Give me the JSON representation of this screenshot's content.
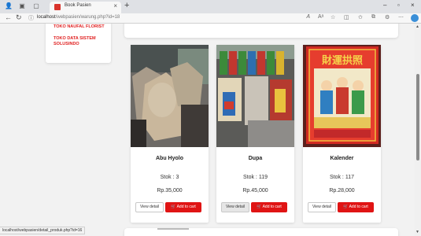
{
  "browser": {
    "tab_title": "Book Pasien",
    "tab_close": "×",
    "new_tab": "+",
    "url_host": "localhost",
    "url_path": "/webpasien/warung.php?id=18",
    "controls": {
      "minimize": "–",
      "maximize": "▫",
      "close": "×"
    }
  },
  "sidebar": {
    "stores": [
      {
        "label": "TOKO NAUFAL FLORIST"
      },
      {
        "label": "TOKO DATA SISTEM SOLUSINDO"
      }
    ]
  },
  "products": [
    {
      "name": "Abu Hyolo",
      "stock": "Stok : 3",
      "price": "Rp.35,000",
      "detail_label": "View detail",
      "cart_label": "Add to cart"
    },
    {
      "name": "Dupa",
      "stock": "Stok : 119",
      "price": "Rp.45,000",
      "detail_label": "View detail",
      "cart_label": "Add to cart"
    },
    {
      "name": "Kalender",
      "stock": "Stok : 117",
      "price": "Rp.28,000",
      "detail_label": "View detail",
      "cart_label": "Add to cart"
    }
  ],
  "kalender_title": "財運拱照",
  "status_bar": {
    "url": "localhost/webpasien/detail_produk.php?id=16"
  },
  "colors": {
    "accent": "#e01414",
    "link": "#e02020"
  }
}
